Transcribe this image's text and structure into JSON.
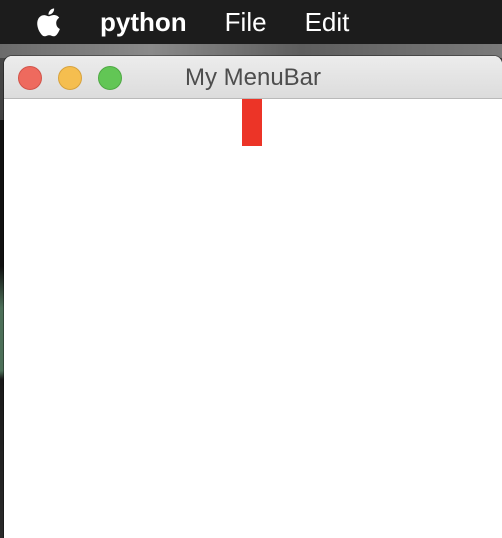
{
  "menubar": {
    "apple_icon": "apple-icon",
    "app_name": "python",
    "items": [
      {
        "label": "File"
      },
      {
        "label": "Edit"
      }
    ]
  },
  "window": {
    "title": "My MenuBar",
    "controls": [
      "close",
      "minimize",
      "zoom"
    ]
  },
  "colors": {
    "menubar_bg": "#1c1c1c",
    "close": "#ee6a5e",
    "minimize": "#f5be4f",
    "zoom": "#62c655",
    "red_widget": "#ec3427"
  }
}
